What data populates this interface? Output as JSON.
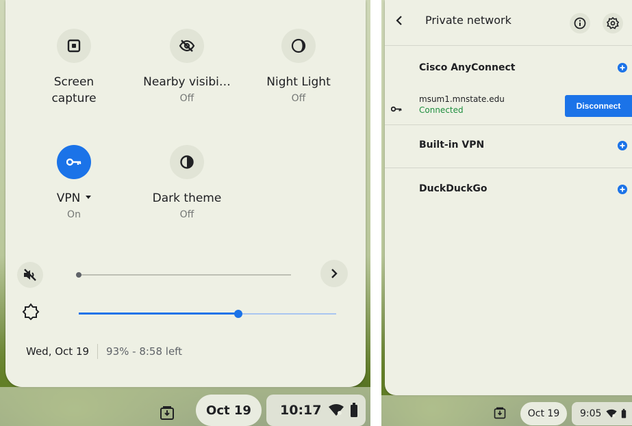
{
  "left": {
    "tiles": [
      {
        "label": "Screen\ncapture",
        "status": "",
        "icon": "screen-capture-icon"
      },
      {
        "label": "Nearby visibi…",
        "status": "Off",
        "icon": "nearby-visibility-off-icon"
      },
      {
        "label": "Night Light",
        "status": "Off",
        "icon": "night-light-icon"
      },
      {
        "label": "VPN",
        "status": "On",
        "icon": "vpn-key-icon"
      },
      {
        "label": "Dark theme",
        "status": "Off",
        "icon": "dark-theme-icon"
      }
    ],
    "volume_level": 0,
    "brightness_level": 0.62,
    "footer": {
      "date": "Wed, Oct 19",
      "battery": "93% - 8:58 left"
    },
    "shelf": {
      "date": "Oct 19",
      "time": "10:17"
    }
  },
  "right": {
    "header": {
      "title": "Private network"
    },
    "providers": [
      {
        "name": "Cisco AnyConnect"
      },
      {
        "name": "Built-in VPN"
      },
      {
        "name": "DuckDuckGo"
      }
    ],
    "connection": {
      "host": "msum1.mnstate.edu",
      "status": "Connected",
      "button": "Disconnect"
    },
    "shelf": {
      "date": "Oct 19",
      "time": "9:05"
    }
  },
  "colors": {
    "accent": "#1b73e8",
    "connected": "#1e8e3e",
    "panel": "#eef0e4"
  }
}
